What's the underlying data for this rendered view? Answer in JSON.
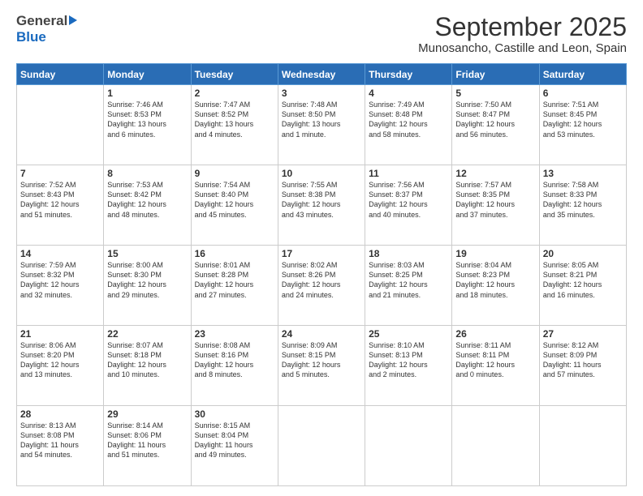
{
  "header": {
    "logo_general": "General",
    "logo_blue": "Blue",
    "title": "September 2025",
    "location": "Munosancho, Castille and Leon, Spain"
  },
  "days_of_week": [
    "Sunday",
    "Monday",
    "Tuesday",
    "Wednesday",
    "Thursday",
    "Friday",
    "Saturday"
  ],
  "weeks": [
    [
      {
        "day": "",
        "info": ""
      },
      {
        "day": "1",
        "info": "Sunrise: 7:46 AM\nSunset: 8:53 PM\nDaylight: 13 hours\nand 6 minutes."
      },
      {
        "day": "2",
        "info": "Sunrise: 7:47 AM\nSunset: 8:52 PM\nDaylight: 13 hours\nand 4 minutes."
      },
      {
        "day": "3",
        "info": "Sunrise: 7:48 AM\nSunset: 8:50 PM\nDaylight: 13 hours\nand 1 minute."
      },
      {
        "day": "4",
        "info": "Sunrise: 7:49 AM\nSunset: 8:48 PM\nDaylight: 12 hours\nand 58 minutes."
      },
      {
        "day": "5",
        "info": "Sunrise: 7:50 AM\nSunset: 8:47 PM\nDaylight: 12 hours\nand 56 minutes."
      },
      {
        "day": "6",
        "info": "Sunrise: 7:51 AM\nSunset: 8:45 PM\nDaylight: 12 hours\nand 53 minutes."
      }
    ],
    [
      {
        "day": "7",
        "info": "Sunrise: 7:52 AM\nSunset: 8:43 PM\nDaylight: 12 hours\nand 51 minutes."
      },
      {
        "day": "8",
        "info": "Sunrise: 7:53 AM\nSunset: 8:42 PM\nDaylight: 12 hours\nand 48 minutes."
      },
      {
        "day": "9",
        "info": "Sunrise: 7:54 AM\nSunset: 8:40 PM\nDaylight: 12 hours\nand 45 minutes."
      },
      {
        "day": "10",
        "info": "Sunrise: 7:55 AM\nSunset: 8:38 PM\nDaylight: 12 hours\nand 43 minutes."
      },
      {
        "day": "11",
        "info": "Sunrise: 7:56 AM\nSunset: 8:37 PM\nDaylight: 12 hours\nand 40 minutes."
      },
      {
        "day": "12",
        "info": "Sunrise: 7:57 AM\nSunset: 8:35 PM\nDaylight: 12 hours\nand 37 minutes."
      },
      {
        "day": "13",
        "info": "Sunrise: 7:58 AM\nSunset: 8:33 PM\nDaylight: 12 hours\nand 35 minutes."
      }
    ],
    [
      {
        "day": "14",
        "info": "Sunrise: 7:59 AM\nSunset: 8:32 PM\nDaylight: 12 hours\nand 32 minutes."
      },
      {
        "day": "15",
        "info": "Sunrise: 8:00 AM\nSunset: 8:30 PM\nDaylight: 12 hours\nand 29 minutes."
      },
      {
        "day": "16",
        "info": "Sunrise: 8:01 AM\nSunset: 8:28 PM\nDaylight: 12 hours\nand 27 minutes."
      },
      {
        "day": "17",
        "info": "Sunrise: 8:02 AM\nSunset: 8:26 PM\nDaylight: 12 hours\nand 24 minutes."
      },
      {
        "day": "18",
        "info": "Sunrise: 8:03 AM\nSunset: 8:25 PM\nDaylight: 12 hours\nand 21 minutes."
      },
      {
        "day": "19",
        "info": "Sunrise: 8:04 AM\nSunset: 8:23 PM\nDaylight: 12 hours\nand 18 minutes."
      },
      {
        "day": "20",
        "info": "Sunrise: 8:05 AM\nSunset: 8:21 PM\nDaylight: 12 hours\nand 16 minutes."
      }
    ],
    [
      {
        "day": "21",
        "info": "Sunrise: 8:06 AM\nSunset: 8:20 PM\nDaylight: 12 hours\nand 13 minutes."
      },
      {
        "day": "22",
        "info": "Sunrise: 8:07 AM\nSunset: 8:18 PM\nDaylight: 12 hours\nand 10 minutes."
      },
      {
        "day": "23",
        "info": "Sunrise: 8:08 AM\nSunset: 8:16 PM\nDaylight: 12 hours\nand 8 minutes."
      },
      {
        "day": "24",
        "info": "Sunrise: 8:09 AM\nSunset: 8:15 PM\nDaylight: 12 hours\nand 5 minutes."
      },
      {
        "day": "25",
        "info": "Sunrise: 8:10 AM\nSunset: 8:13 PM\nDaylight: 12 hours\nand 2 minutes."
      },
      {
        "day": "26",
        "info": "Sunrise: 8:11 AM\nSunset: 8:11 PM\nDaylight: 12 hours\nand 0 minutes."
      },
      {
        "day": "27",
        "info": "Sunrise: 8:12 AM\nSunset: 8:09 PM\nDaylight: 11 hours\nand 57 minutes."
      }
    ],
    [
      {
        "day": "28",
        "info": "Sunrise: 8:13 AM\nSunset: 8:08 PM\nDaylight: 11 hours\nand 54 minutes."
      },
      {
        "day": "29",
        "info": "Sunrise: 8:14 AM\nSunset: 8:06 PM\nDaylight: 11 hours\nand 51 minutes."
      },
      {
        "day": "30",
        "info": "Sunrise: 8:15 AM\nSunset: 8:04 PM\nDaylight: 11 hours\nand 49 minutes."
      },
      {
        "day": "",
        "info": ""
      },
      {
        "day": "",
        "info": ""
      },
      {
        "day": "",
        "info": ""
      },
      {
        "day": "",
        "info": ""
      }
    ]
  ]
}
